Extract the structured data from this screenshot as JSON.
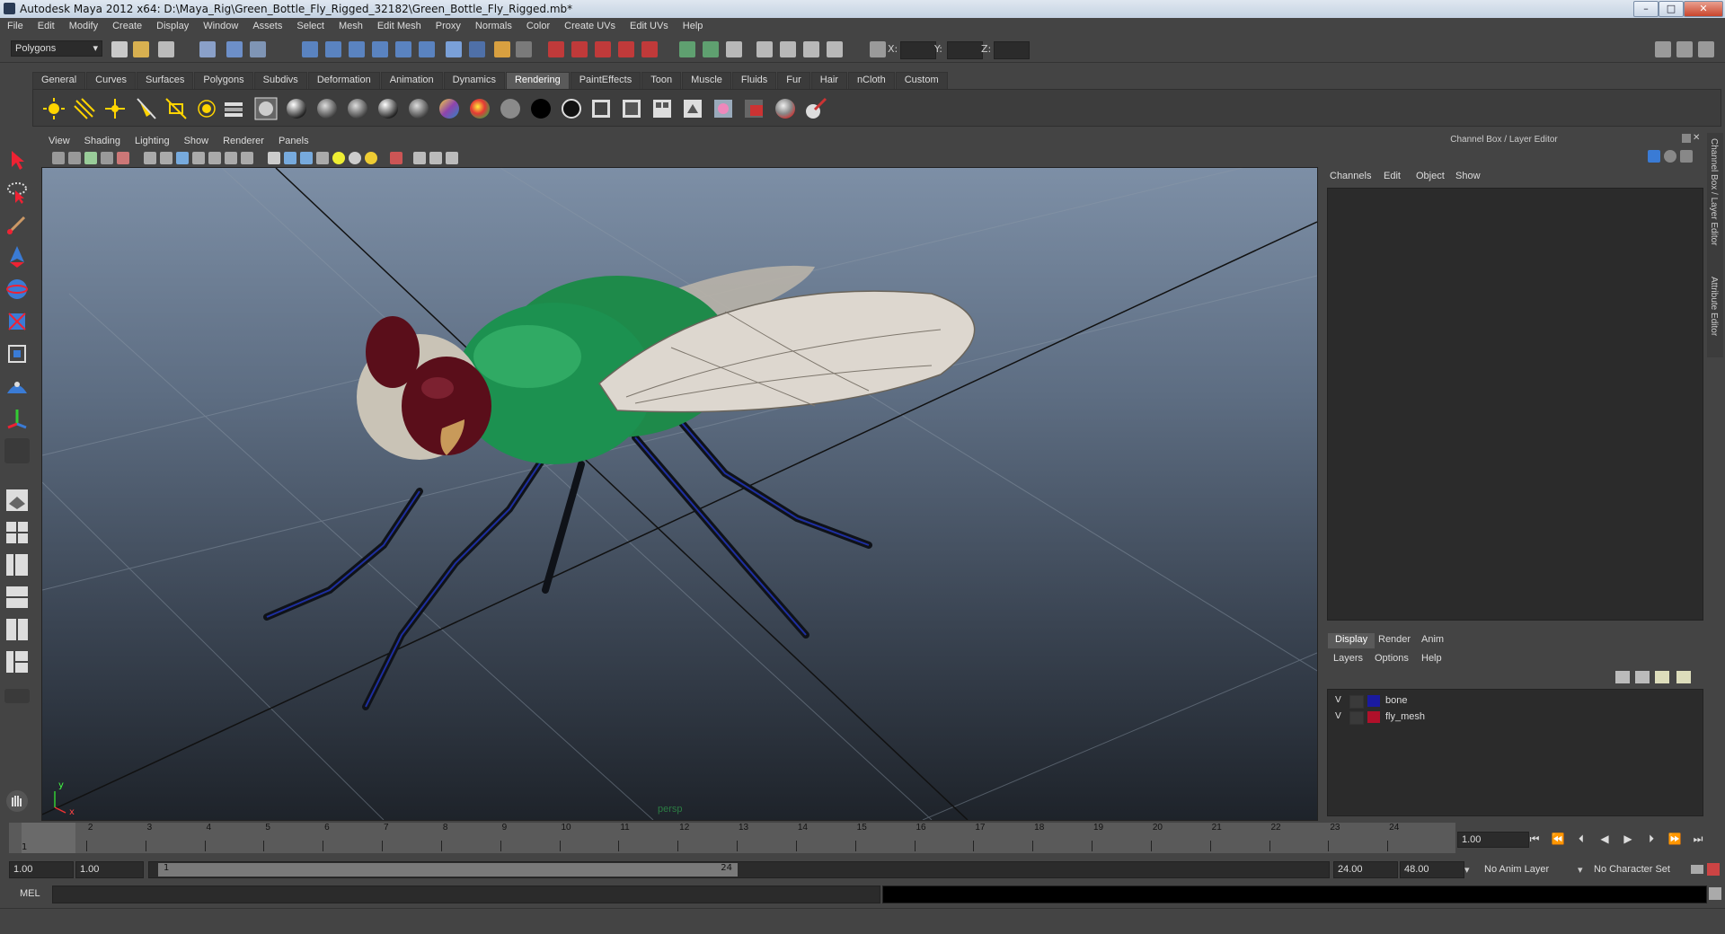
{
  "window": {
    "title": "Autodesk Maya 2012 x64: D:\\Maya_Rig\\Green_Bottle_Fly_Rigged_32182\\Green_Bottle_Fly_Rigged.mb*"
  },
  "menubar": [
    "File",
    "Edit",
    "Modify",
    "Create",
    "Display",
    "Window",
    "Assets",
    "Select",
    "Mesh",
    "Edit Mesh",
    "Proxy",
    "Normals",
    "Color",
    "Create UVs",
    "Edit UVs",
    "Help"
  ],
  "statusline": {
    "mode": "Polygons",
    "x_label": "X:",
    "y_label": "Y:",
    "z_label": "Z:"
  },
  "shelf": {
    "tabs": [
      "General",
      "Curves",
      "Surfaces",
      "Polygons",
      "Subdivs",
      "Deformation",
      "Animation",
      "Dynamics",
      "Rendering",
      "PaintEffects",
      "Toon",
      "Muscle",
      "Fluids",
      "Fur",
      "Hair",
      "nCloth",
      "Custom"
    ],
    "active_tab": "Rendering"
  },
  "viewport": {
    "menu": [
      "View",
      "Shading",
      "Lighting",
      "Show",
      "Renderer",
      "Panels"
    ],
    "camera_label": "persp",
    "axis_y": "y",
    "axis_x": "x"
  },
  "channel_box": {
    "title": "Channel Box / Layer Editor",
    "menu": [
      "Channels",
      "Edit",
      "Object",
      "Show"
    ]
  },
  "layer_editor": {
    "tabs": [
      "Display",
      "Render",
      "Anim"
    ],
    "active_tab": "Display",
    "menu": [
      "Layers",
      "Options",
      "Help"
    ],
    "layers": [
      {
        "visible": "V",
        "name": "bone",
        "color": "#1a1aa0"
      },
      {
        "visible": "V",
        "name": "fly_mesh",
        "color": "#b0102a"
      }
    ]
  },
  "side_tabs": [
    "Channel Box / Layer Editor",
    "Attribute Editor"
  ],
  "timeline": {
    "ticks": [
      "1",
      "2",
      "3",
      "4",
      "5",
      "6",
      "7",
      "8",
      "9",
      "10",
      "11",
      "12",
      "13",
      "14",
      "15",
      "16",
      "17",
      "18",
      "19",
      "20",
      "21",
      "22",
      "23",
      "24"
    ],
    "current_frame": "1",
    "current_field": "1.00"
  },
  "range": {
    "start": "1.00",
    "playback_start": "1.00",
    "slider_start": "1",
    "slider_end": "24",
    "playback_end": "24.00",
    "end": "48.00",
    "anim_layer": "No Anim Layer",
    "character_set": "No Character Set"
  },
  "commandline": {
    "label": "MEL"
  }
}
